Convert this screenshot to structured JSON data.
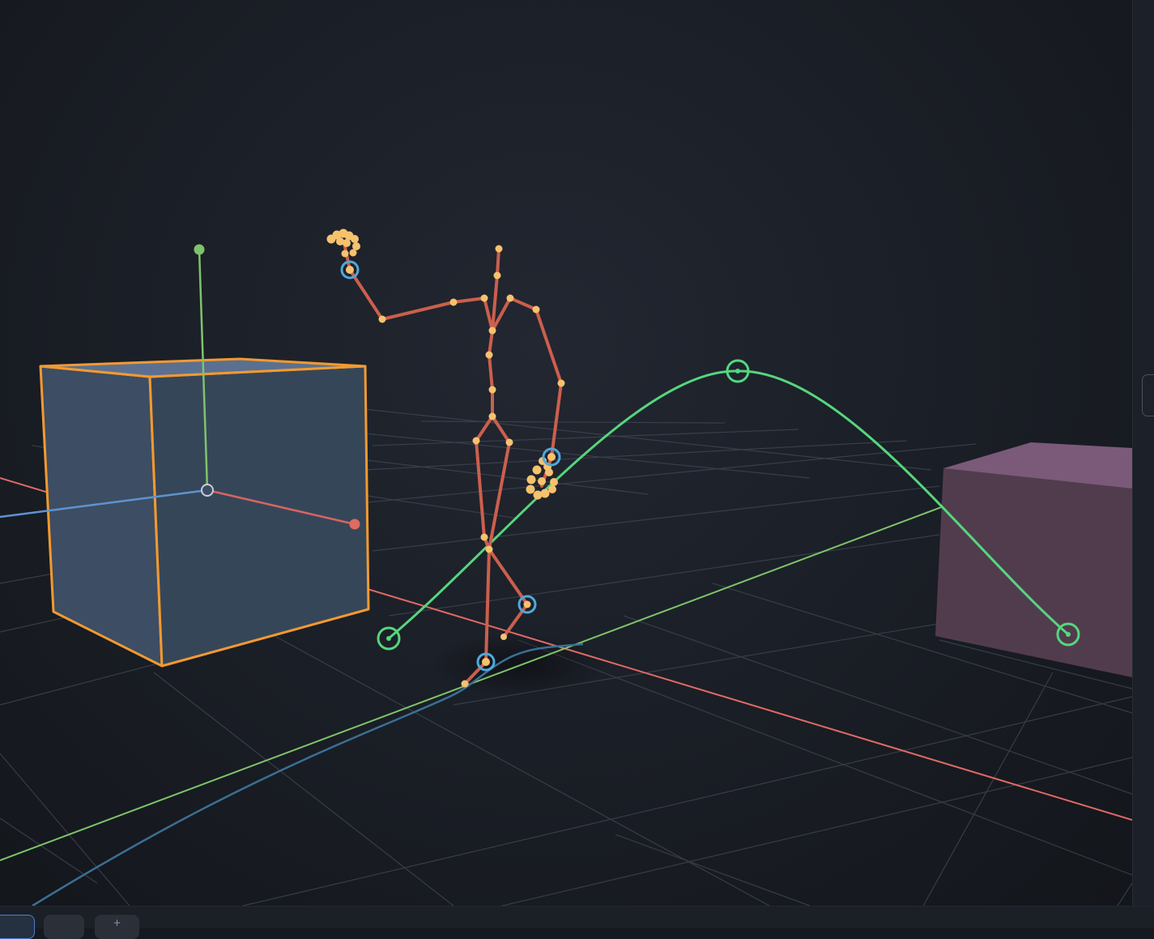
{
  "viewport": {
    "background_color": "#1b1f27",
    "grid_color": "#414855",
    "axes": {
      "x_color": "#e06a64",
      "y_color": "#7ec36c",
      "z_color": "#5f93cf"
    }
  },
  "objects": {
    "selected_cube": {
      "face_color": "#3a4a5f",
      "outline_color": "#f39a30",
      "selected": true
    },
    "purple_cube": {
      "face_color": "#513c4d",
      "top_color": "#7a5a78"
    },
    "armature": {
      "bone_color": "#cb5f4d",
      "joint_color": "#f7c26e",
      "ik_target_color": "#4fa9dc"
    },
    "motion_path": {
      "color": "#56d67e"
    },
    "trajectory_curve": {
      "color": "#3b6f94"
    }
  },
  "gizmo": {
    "center_color": "#c9ced6",
    "x_handle_color": "#e06a64",
    "y_handle_color": "#7ec36c",
    "z_handle_color": "#5f93cf"
  },
  "bottom_toolbar": {
    "buttons": [
      {
        "icon": "select-icon",
        "glyph": "",
        "active": true
      },
      {
        "icon": "move-icon",
        "glyph": "",
        "active": false
      },
      {
        "icon": "add-icon",
        "glyph": "+",
        "active": false
      }
    ]
  },
  "side_panel": {
    "handle_icon": "panel-handle-icon"
  }
}
